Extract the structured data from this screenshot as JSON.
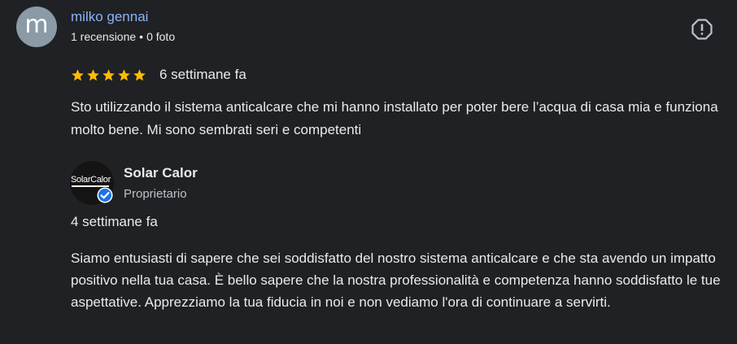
{
  "review": {
    "avatar_initial": "m",
    "author_name": "milko gennai",
    "review_count": "1 recensione",
    "meta_separator": "•",
    "photo_count": "0 foto",
    "report_icon": "report-flag-icon",
    "rating": 5,
    "rating_max": 5,
    "star_color": "#fbbc04",
    "date": "6 settimane fa",
    "text": "Sto utilizzando il sistema anticalcare che mi hanno installato per poter bere l’acqua di casa mia e funziona molto bene. Mi sono sembrati seri e competenti"
  },
  "owner_reply": {
    "logo_text": "SolarCalor",
    "verified_icon": "verified-badge-icon",
    "name": "Solar Calor",
    "role": "Proprietario",
    "date": "4 settimane fa",
    "text": "Siamo entusiasti di sapere che sei soddisfatto del nostro sistema anticalcare e che sta avendo un impatto positivo nella tua casa. È bello sapere che la nostra professionalità e competenza hanno soddisfatto le tue aspettative. Apprezziamo la tua fiducia in noi e non vediamo l'ora di continuare a servirti."
  },
  "colors": {
    "background": "#202124",
    "author_link": "#8ab4f8",
    "text": "#e8eaed",
    "secondary_text": "#bdc1c6",
    "avatar_bg": "#8a9aa7",
    "verified_blue": "#1a73e8"
  }
}
